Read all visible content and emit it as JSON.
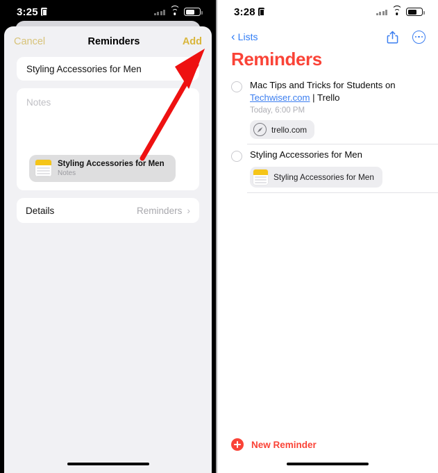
{
  "colors": {
    "accent_red": "#fa4337",
    "link_blue": "#3b7ef0",
    "add_gold": "#d9b63c",
    "cancel_gold": "#d8c379",
    "annotation_red": "#ee1111",
    "notes_yellow": "#f5c518"
  },
  "left_phone": {
    "status": {
      "time": "3:25",
      "lock_icon": "lock-icon",
      "signal_icon": "cellular-signal-icon",
      "wifi_icon": "wifi-icon",
      "battery_icon": "battery-icon"
    },
    "sheet": {
      "cancel_label": "Cancel",
      "title": "Reminders",
      "add_label": "Add",
      "title_field_value": "Styling Accessories for Men",
      "notes_placeholder": "Notes",
      "attachment": {
        "icon": "notes-app-icon",
        "title": "Styling Accessories for Men",
        "subtitle": "Notes"
      },
      "details_row": {
        "label": "Details",
        "value": "Reminders",
        "chevron": "chevron-right-icon"
      }
    }
  },
  "right_phone": {
    "status": {
      "time": "3:28",
      "lock_icon": "lock-icon",
      "signal_icon": "cellular-signal-icon",
      "wifi_icon": "wifi-icon",
      "battery_icon": "battery-icon"
    },
    "nav": {
      "back_label": "Lists",
      "back_icon": "chevron-left-icon",
      "share_icon": "share-icon",
      "more_icon": "more-circle-icon"
    },
    "list_title": "Reminders",
    "reminders": [
      {
        "text_part1": "Mac Tips and Tricks for Students on ",
        "link_text": "Techwiser.com",
        "text_part2": " | Trello",
        "due": "Today, 6:00 PM",
        "chip": {
          "icon": "safari-compass-icon",
          "label": "trello.com"
        }
      },
      {
        "text_part1": "Styling Accessories for Men",
        "chip": {
          "icon": "notes-app-icon",
          "label": "Styling Accessories for Men"
        }
      }
    ],
    "new_reminder": {
      "icon": "plus-circle-icon",
      "label": "New Reminder"
    }
  },
  "annotation": {
    "type": "arrow",
    "points_to": "Add",
    "color": "#ee1111"
  }
}
